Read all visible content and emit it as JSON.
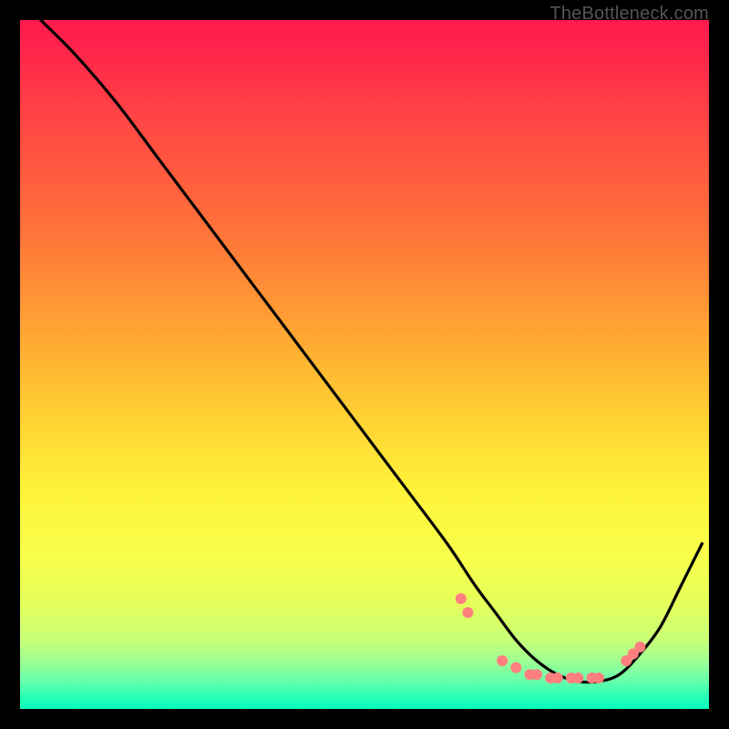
{
  "attribution": "TheBottleneck.com",
  "chart_data": {
    "type": "line",
    "title": "",
    "xlabel": "",
    "ylabel": "",
    "xlim": [
      0,
      100
    ],
    "ylim": [
      0,
      100
    ],
    "series": [
      {
        "name": "curve",
        "x": [
          3,
          8,
          14,
          20,
          26,
          32,
          38,
          44,
          50,
          56,
          62,
          66,
          69,
          72,
          75,
          78,
          81,
          84,
          87,
          90,
          93,
          96,
          99
        ],
        "y": [
          100,
          95,
          88,
          80,
          72,
          64,
          56,
          48,
          40,
          32,
          24,
          18,
          14,
          10,
          7,
          5,
          4,
          4,
          5,
          8,
          12,
          18,
          24
        ]
      }
    ],
    "markers": {
      "name": "highlight-dots",
      "x": [
        64,
        65,
        70,
        72,
        74,
        75,
        77,
        78,
        80,
        81,
        83,
        84,
        88,
        89,
        90
      ],
      "y": [
        16,
        14,
        7,
        6,
        5,
        5,
        4.5,
        4.5,
        4.5,
        4.5,
        4.5,
        4.5,
        7,
        8,
        9
      ],
      "color": "#ff7f7f",
      "size": 6
    }
  }
}
